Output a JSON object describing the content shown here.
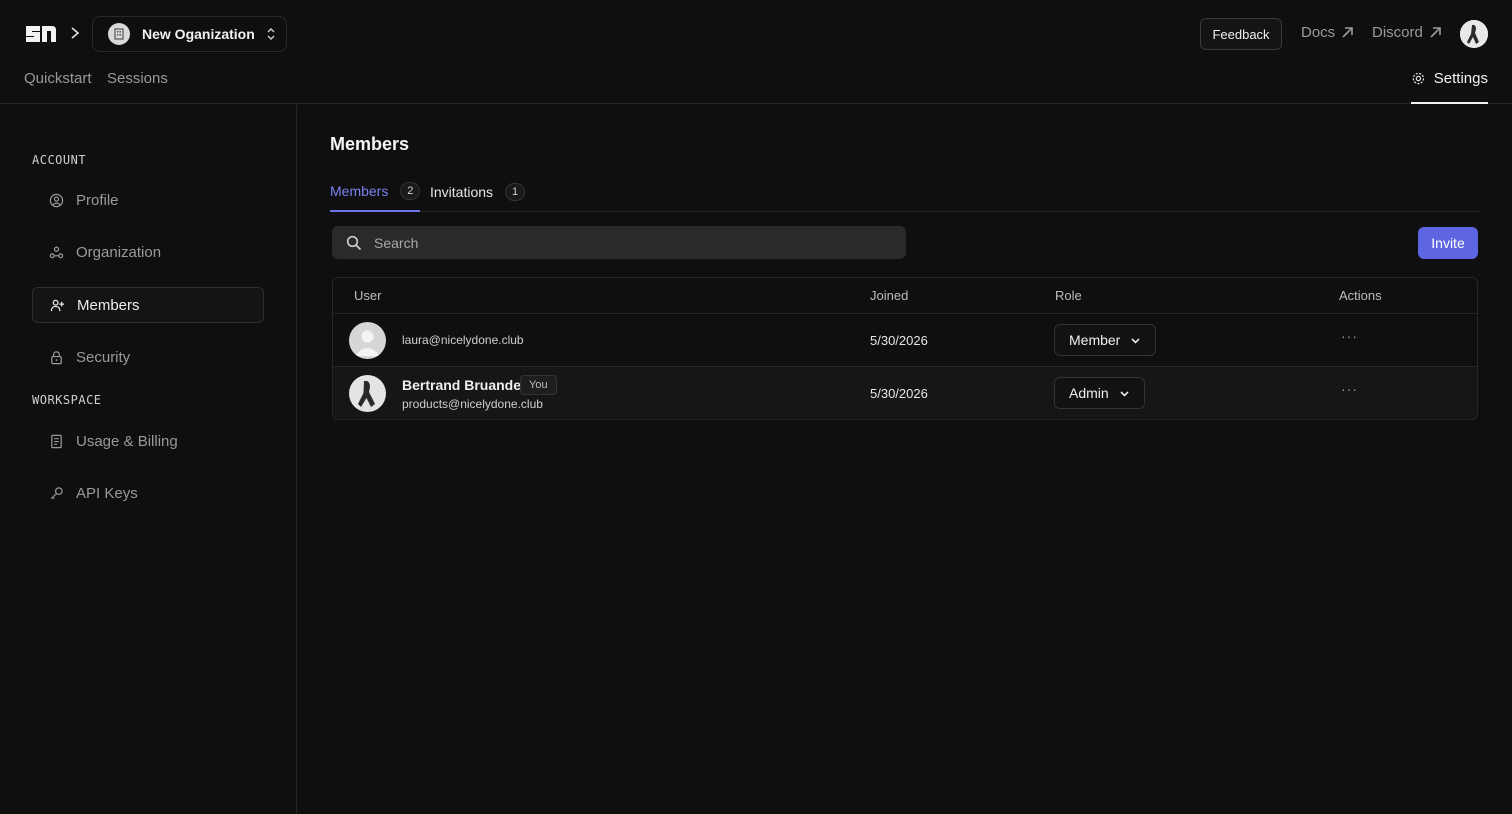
{
  "header": {
    "org_name": "New Oganization",
    "feedback_label": "Feedback",
    "docs_label": "Docs",
    "discord_label": "Discord"
  },
  "nav": {
    "quickstart": "Quickstart",
    "sessions": "Sessions",
    "settings": "Settings"
  },
  "sidebar": {
    "account_section": "ACCOUNT",
    "workspace_section": "WORKSPACE",
    "items": [
      {
        "label": "Profile",
        "icon": "user-circle-icon"
      },
      {
        "label": "Organization",
        "icon": "organization-icon"
      },
      {
        "label": "Members",
        "icon": "user-plus-icon",
        "active": true
      },
      {
        "label": "Security",
        "icon": "lock-icon"
      },
      {
        "label": "Usage & Billing",
        "icon": "receipt-icon"
      },
      {
        "label": "API Keys",
        "icon": "key-icon"
      }
    ]
  },
  "main": {
    "title": "Members",
    "tabs": [
      {
        "label": "Members",
        "count": "2",
        "active": true
      },
      {
        "label": "Invitations",
        "count": "1"
      }
    ],
    "search_placeholder": "Search",
    "invite_label": "Invite",
    "table": {
      "columns": [
        "User",
        "Joined",
        "Role",
        "Actions"
      ],
      "rows": [
        {
          "name": "",
          "email": "laura@nicelydone.club",
          "joined": "5/30/2026",
          "role": "Member",
          "you": ""
        },
        {
          "name": "Bertrand Bruandet",
          "email": "products@nicelydone.club",
          "joined": "5/30/2026",
          "role": "Admin",
          "you": "You"
        }
      ],
      "actions_glyph": "···"
    }
  },
  "colors": {
    "background": "#0f0f0f",
    "accent": "#5d66e0",
    "active_tab": "#7b83f2"
  }
}
